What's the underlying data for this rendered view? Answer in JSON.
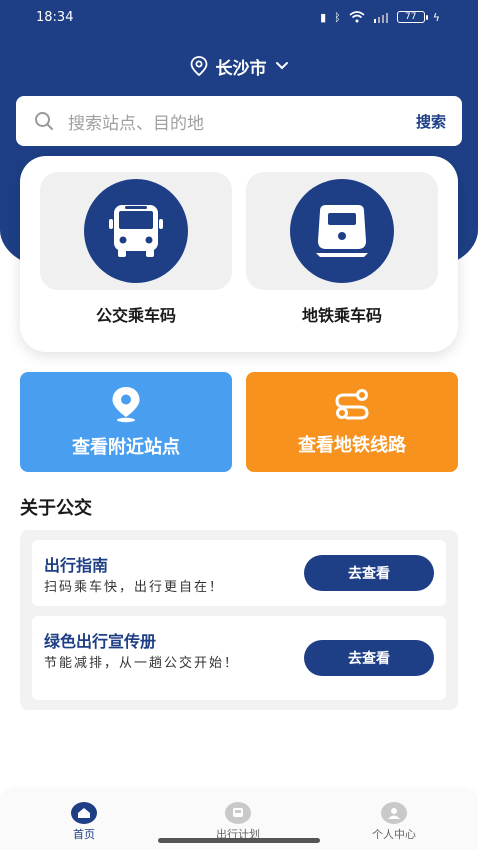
{
  "status_bar": {
    "time": "18:34",
    "battery": "77"
  },
  "header": {
    "city": "长沙市"
  },
  "search": {
    "placeholder": "搜索站点、目的地",
    "button_label": "搜索"
  },
  "ride_codes": [
    {
      "label": "公交乘车码",
      "icon": "bus-icon"
    },
    {
      "label": "地铁乘车码",
      "icon": "metro-icon"
    }
  ],
  "actions": [
    {
      "label": "查看附近站点",
      "icon": "location-pin-icon",
      "color": "#4a9ef0"
    },
    {
      "label": "查看地铁线路",
      "icon": "route-icon",
      "color": "#f7921e"
    }
  ],
  "about": {
    "section_title": "关于公交",
    "cards": [
      {
        "title": "出行指南",
        "desc": "扫码乘车快，出行更自在！",
        "button_label": "去查看"
      },
      {
        "title": "绿色出行宣传册",
        "desc": "节能减排，从一趟公交开始！",
        "button_label": "去查看"
      }
    ]
  },
  "tabbar": {
    "items": [
      {
        "label": "首页",
        "active": true
      },
      {
        "label": "出行计划",
        "active": false
      },
      {
        "label": "个人中心",
        "active": false
      }
    ]
  },
  "colors": {
    "primary": "#1e3f86",
    "accent_blue": "#4a9ef0",
    "accent_orange": "#f7921e"
  }
}
